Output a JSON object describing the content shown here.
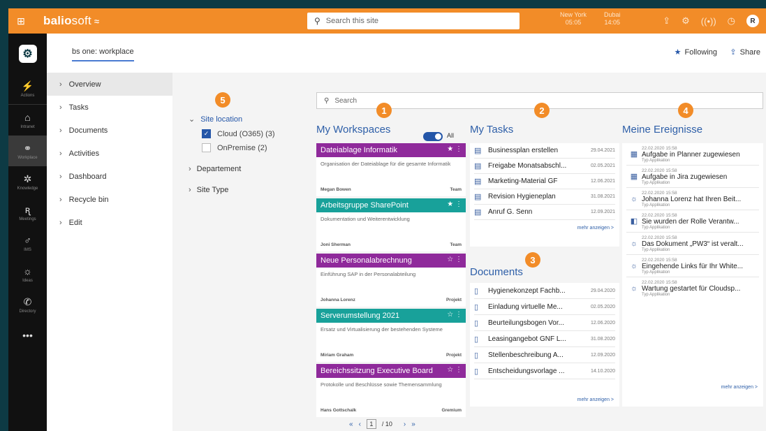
{
  "topbar": {
    "brand_bold": "balio",
    "brand_light": "soft",
    "search_placeholder": "Search this site",
    "clocks": [
      {
        "city": "New York",
        "time": "05:05"
      },
      {
        "city": "Dubai",
        "time": "14:05"
      }
    ],
    "avatar": "R"
  },
  "rail": {
    "items": [
      {
        "label": "Actions",
        "icon": "⚡"
      },
      {
        "label": "Intranet",
        "icon": "⌂"
      },
      {
        "label": "Workplace",
        "icon": "⚭"
      },
      {
        "label": "Knowledge",
        "icon": "✲"
      },
      {
        "label": "Meetings",
        "icon": "ꭆ"
      },
      {
        "label": "IMS",
        "icon": "♂"
      },
      {
        "label": "Ideas",
        "icon": "☼"
      },
      {
        "label": "Directory",
        "icon": "✆"
      }
    ],
    "more": "•••"
  },
  "header": {
    "site_title": "bs one: workplace",
    "following": "Following",
    "share": "Share"
  },
  "nav": {
    "items": [
      "Overview",
      "Tasks",
      "Documents",
      "Activities",
      "Dashboard",
      "Recycle bin",
      "Edit"
    ]
  },
  "filters": {
    "badge": "5",
    "site_location": "Site location",
    "options": [
      {
        "label": "Cloud (O365) (3)",
        "checked": true
      },
      {
        "label": "OnPremise (2)",
        "checked": false
      }
    ],
    "departement": "Departement",
    "site_type": "Site Type"
  },
  "search": {
    "placeholder": "Search"
  },
  "workspaces": {
    "badge": "1",
    "title": "My Workspaces",
    "toggle_label": "All",
    "cards": [
      {
        "title": "Dateiablage Informatik",
        "desc": "Organisation der Dateiablage für die gesamte Informatik",
        "owner": "Megan Bowen",
        "type": "Team",
        "color": "#8f2a9b",
        "star": "★"
      },
      {
        "title": "Arbeitsgruppe SharePoint",
        "desc": "Dokumentation und Weiterentwicklung",
        "owner": "Joni Sherman",
        "type": "Team",
        "color": "#18a19a",
        "star": "★"
      },
      {
        "title": "Neue Personalabrechnung",
        "desc": "Einführung SAP in der Personalabteilung",
        "owner": "Johanna Lorenz",
        "type": "Projekt",
        "color": "#8f2a9b",
        "star": "☆"
      },
      {
        "title": "Serverumstellung 2021",
        "desc": "Ersatz und Virtualisierung der bestehenden Systeme",
        "owner": "Miriam Graham",
        "type": "Projekt",
        "color": "#18a19a",
        "star": "☆"
      },
      {
        "title": "Bereichssitzung Executive Board",
        "desc": "Protokolle und Beschlüsse sowie Themensammlung",
        "owner": "Hans Gottschalk",
        "type": "Gremium",
        "color": "#8f2a9b",
        "star": "☆"
      }
    ]
  },
  "tasks": {
    "badge": "2",
    "title": "My Tasks",
    "rows": [
      {
        "name": "Businessplan erstellen",
        "date": "29.04.2021"
      },
      {
        "name": "Freigabe Monatsabschl...",
        "date": "02.05.2021"
      },
      {
        "name": "Marketing-Material GF",
        "date": "12.06.2021"
      },
      {
        "name": "Revision Hygieneplan",
        "date": "31.08.2021"
      },
      {
        "name": "Anruf G. Senn",
        "date": "12.09.2021"
      }
    ],
    "more": "mehr anzeigen >"
  },
  "documents": {
    "badge": "3",
    "title": "Documents",
    "rows": [
      {
        "name": "Hygienekonzept Fachb...",
        "date": "29.04.2020"
      },
      {
        "name": "Einladung virtuelle Me...",
        "date": "02.05.2020"
      },
      {
        "name": "Beurteilungsbogen Vor...",
        "date": "12.06.2020"
      },
      {
        "name": "Leasingangebot GNF L...",
        "date": "31.08.2020"
      },
      {
        "name": "Stellenbeschreibung A...",
        "date": "12.09.2020"
      },
      {
        "name": "Entscheidungsvorlage ...",
        "date": "14.10.2020"
      }
    ],
    "more": "mehr anzeigen >"
  },
  "events": {
    "badge": "4",
    "title": "Meine Ereignisse",
    "rows": [
      {
        "date": "22.02.2020 15:58",
        "title": "Aufgabe in Planner zugewiesen",
        "type": "Typ Applikation",
        "icon": "▦"
      },
      {
        "date": "22.02.2020 15:58",
        "title": "Aufgabe in Jira zugewiesen",
        "type": "Typ Applikation",
        "icon": "▦"
      },
      {
        "date": "22.02.2020 15:58",
        "title": "Johanna Lorenz hat Ihren Beit...",
        "type": "Typ Applikation",
        "icon": "☼"
      },
      {
        "date": "22.02.2020 15:58",
        "title": "Sie wurden der Rolle Verantw...",
        "type": "Typ Applikation",
        "icon": "◧"
      },
      {
        "date": "22.02.2020 15:58",
        "title": "Das Dokument „PW3“ ist veralt...",
        "type": "Typ Applikation",
        "icon": "☼"
      },
      {
        "date": "22.02.2020 15:58",
        "title": "Eingehende Links für Ihr White...",
        "type": "Typ Applikation",
        "icon": "☼"
      },
      {
        "date": "22.02.2020 15:58",
        "title": "Wartung gestartet für Cloudsp...",
        "type": "Typ Applikation",
        "icon": "☼"
      }
    ],
    "more": "mehr anzeigen >"
  },
  "pager": {
    "current": "1",
    "total": "/ 10"
  }
}
